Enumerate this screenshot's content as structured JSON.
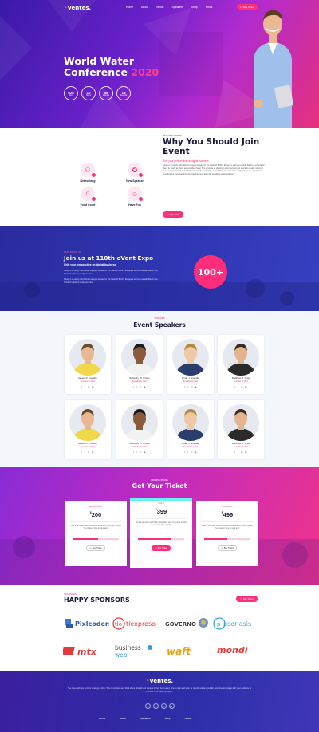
{
  "nav": {
    "logo": "Ventes.",
    "links": [
      "Home",
      "About",
      "Venue",
      "Speakers",
      "Shop",
      "News"
    ],
    "cta": "Buy Ticket"
  },
  "hero": {
    "title_line1": "World Water",
    "title_line2": "Conference",
    "title_year": "2020",
    "countdown": [
      {
        "value": "528",
        "unit": "Days"
      },
      {
        "value": "10",
        "unit": "Hours"
      },
      {
        "value": "58",
        "unit": "Minutes"
      },
      {
        "value": "15",
        "unit": "Seconds"
      }
    ]
  },
  "why": {
    "kicker": "WHY ONE EVENT",
    "title": "Why You Should Join Event",
    "subtitle": "Shift your perspective on digital business",
    "body": "Study in a newly refurbished campus located in the heart of Berlin, Europe's start-up capital. Berlin is a fantastic place to study as there are excellent local. The process of planning and executing an event is usually referred to as event planning and which can include budgeting, scheduling, site selection, acquiring necessary permits, coordinating transportation and parking, arranging for speakers or entertainers.",
    "button": "Buy Ticket",
    "features": [
      {
        "label": "Networking",
        "glyph": "⚇"
      },
      {
        "label": "New Speaker",
        "glyph": "✪"
      },
      {
        "label": "Food Court",
        "glyph": "⩍"
      },
      {
        "label": "Have Fun",
        "glyph": "☺"
      }
    ]
  },
  "join": {
    "kicker": "WHY JOIN IN US",
    "title": "Join us at 110th oVent Expo",
    "subtitle": "Shift your perspective on digital business",
    "p1": "Study in a newly refurbished campus located in the heart of Berlin, Europe's start-up capital. Berlin is a fantastic place to study as there.",
    "p2": "Study in a newly refurbished campus located in the heart of Berlin, Europe's start-up capital. Berlin is a fantastic place to study as there.",
    "counter": "100+"
  },
  "speakers": {
    "kicker": "SPEAKER",
    "title": "Event Speakers",
    "items": [
      {
        "name": "James D. Franklin",
        "role": "Founder & CEO",
        "shirt": "#f0d84a",
        "skin": "#e8b892",
        "hair": "#6a4a2e"
      },
      {
        "name": "Nebodky W. Cirsdo",
        "role": "Founder & CEO",
        "shirt": "#f2f2f2",
        "skin": "#8a5a3a",
        "hair": "#1b1b1b"
      },
      {
        "name": "Brian J. Scanlak",
        "role": "Founder & CEO",
        "shirt": "#2b3d6a",
        "skin": "#eec9a6",
        "hair": "#b8893b"
      },
      {
        "name": "Matthew B. Gray",
        "role": "Founder & CEO",
        "shirt": "#2a2a2a",
        "skin": "#e3b58f",
        "hair": "#3b2a1c"
      },
      {
        "name": "James D. Franklin",
        "role": "Founder & CEO",
        "shirt": "#f0d84a",
        "skin": "#e8b892",
        "hair": "#6a4a2e"
      },
      {
        "name": "Nebodky W. Cirsdo",
        "role": "Founder & CEO",
        "shirt": "#f2f2f2",
        "skin": "#8a5a3a",
        "hair": "#1b1b1b"
      },
      {
        "name": "Brian J. Scanlak",
        "role": "Founder & CEO",
        "shirt": "#2b3d6a",
        "skin": "#eec9a6",
        "hair": "#b8893b"
      },
      {
        "name": "Matthew B. Gray",
        "role": "Founder & CEO",
        "shirt": "#2a2a2a",
        "skin": "#e3b58f",
        "hair": "#3b2a1c"
      }
    ],
    "social": [
      "f",
      "t",
      "◎",
      "▶"
    ]
  },
  "tickets": {
    "kicker": "PRICING PLANS",
    "title": "Get Your Ticket",
    "plans": [
      {
        "name": "EARLY BIRD",
        "currency": "$",
        "price": "200",
        "desc": "Time is an down and think about what kind of content should be created, time to stop and",
        "progress": 0.55,
        "left": "SEAT LEFT: 200",
        "button": "Buy Ticket"
      },
      {
        "name": "GOLD",
        "currency": "$",
        "price": "399",
        "desc": "Time is an down and think about what kind of content should be created, time to stop",
        "progress": 0.7,
        "left": "SEAT LEFT: 200",
        "button": "Buy Ticket"
      },
      {
        "name": "PLATINUM",
        "currency": "$",
        "price": "499",
        "desc": "Time is an down and think about what kind of content should be created, time to stop and",
        "progress": 0.5,
        "left": "SEAT LEFT: 200",
        "button": "Buy Ticket"
      }
    ]
  },
  "sponsors": {
    "kicker": "SPONSORS",
    "title": "HAPPY SPONSORS",
    "button": "Buy Ticket",
    "logos": [
      "Pixlcoders",
      "tlexpreso",
      "GOVERNO",
      "psoriasis",
      "mtx",
      "business web",
      "waft",
      "mondi"
    ]
  },
  "footer": {
    "logo": "Ventes.",
    "text": "The issue with any content strategy is time. Time to sit down and think about what kind of content should be created, time to stop and write, or record, edit and publish, and time to engage with your audience to promote the content you post.",
    "social": [
      "f",
      "t",
      "◎",
      "▶"
    ],
    "links": [
      "Home",
      "About",
      "Speakers",
      "Shop",
      "News"
    ]
  },
  "colors": {
    "accent": "#ff2e7a",
    "navy": "#1b1b3a",
    "blue": "#2f36b3",
    "purple": "#6a20c9"
  }
}
